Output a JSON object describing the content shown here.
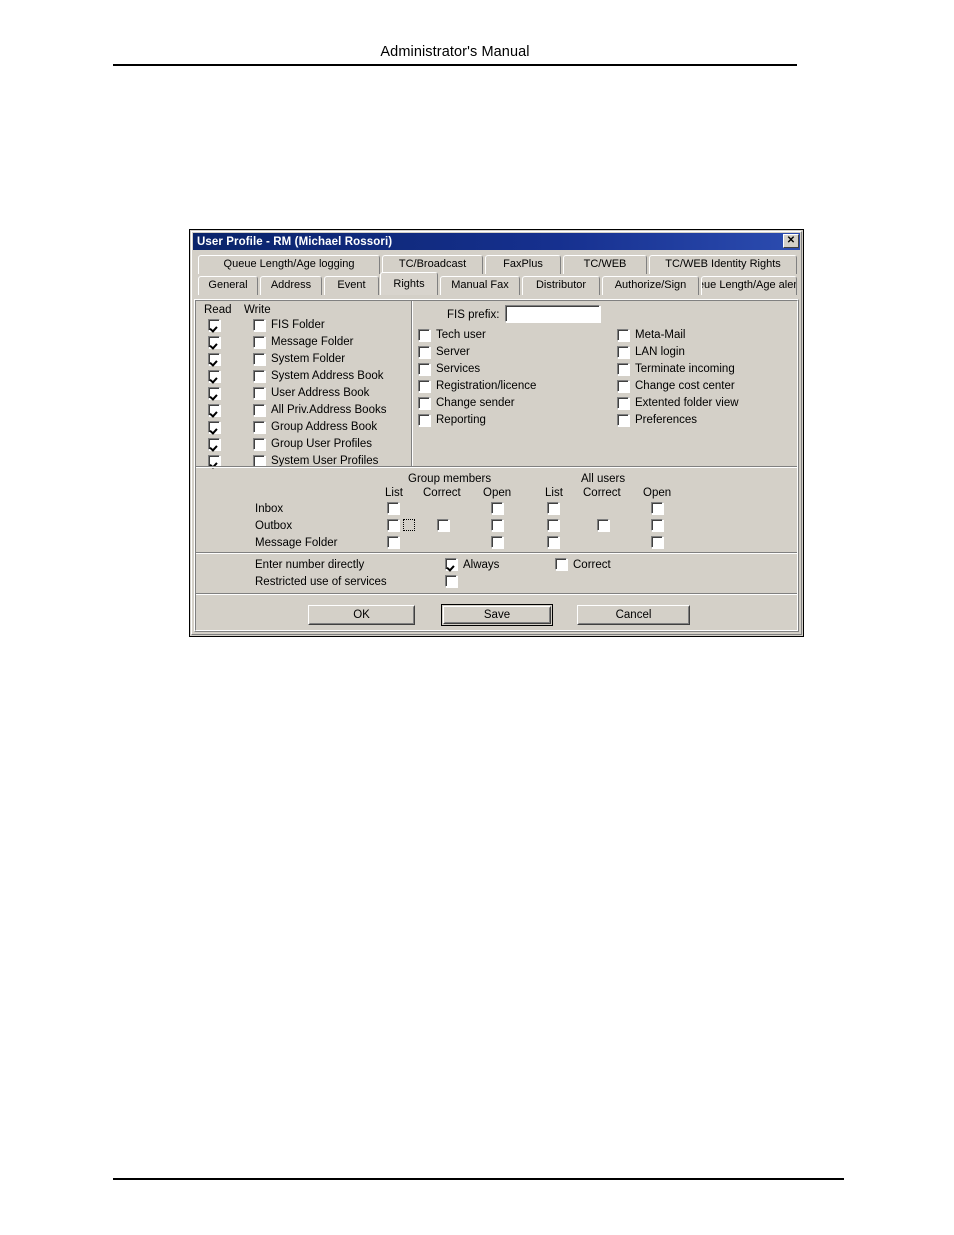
{
  "document": {
    "header_title": "Administrator's Manual"
  },
  "dialog": {
    "title": "User Profile - RM (Michael Rossori)",
    "close_button": "✕",
    "tabs_row1": [
      {
        "label": "Queue Length/Age logging",
        "selected": false
      },
      {
        "label": "TC/Broadcast",
        "selected": false
      },
      {
        "label": "FaxPlus",
        "selected": false
      },
      {
        "label": "TC/WEB",
        "selected": false
      },
      {
        "label": "TC/WEB Identity Rights",
        "selected": false
      }
    ],
    "tabs_row2": [
      {
        "label": "General",
        "selected": false
      },
      {
        "label": "Address",
        "selected": false
      },
      {
        "label": "Event",
        "selected": false
      },
      {
        "label": "Rights",
        "selected": true
      },
      {
        "label": "Manual Fax",
        "selected": false
      },
      {
        "label": "Distributor",
        "selected": false
      },
      {
        "label": "Authorize/Sign",
        "selected": false
      },
      {
        "label": "Queue Length/Age alerting",
        "selected": false
      }
    ],
    "rights_panel": {
      "col_read": "Read",
      "col_write": "Write",
      "rows": [
        {
          "label": "FIS Folder",
          "read": true,
          "write": false
        },
        {
          "label": "Message Folder",
          "read": true,
          "write": false
        },
        {
          "label": "System Folder",
          "read": true,
          "write": false
        },
        {
          "label": "System Address Book",
          "read": true,
          "write": false
        },
        {
          "label": "User Address Book",
          "read": true,
          "write": false
        },
        {
          "label": "All Priv.Address Books",
          "read": true,
          "write": false
        },
        {
          "label": "Group Address Book",
          "read": true,
          "write": false
        },
        {
          "label": "Group User Profiles",
          "read": true,
          "write": false
        },
        {
          "label": "System User Profiles",
          "read": true,
          "write": false
        }
      ]
    },
    "fis_prefix": {
      "label": "FIS prefix:",
      "value": "",
      "placeholder": ""
    },
    "middle_options": [
      {
        "label": "Tech user",
        "checked": false
      },
      {
        "label": "Server",
        "checked": false
      },
      {
        "label": "Services",
        "checked": false
      },
      {
        "label": "Registration/licence",
        "checked": false
      },
      {
        "label": "Change sender",
        "checked": false
      },
      {
        "label": "Reporting",
        "checked": false
      }
    ],
    "right_options": [
      {
        "label": "Meta-Mail",
        "checked": false
      },
      {
        "label": "LAN login",
        "checked": false
      },
      {
        "label": "Terminate incoming",
        "checked": false
      },
      {
        "label": "Change cost center",
        "checked": false
      },
      {
        "label": "Extented folder view",
        "checked": false
      },
      {
        "label": "Preferences",
        "checked": false
      }
    ],
    "access_grid": {
      "group_title": "Group members",
      "all_title": "All users",
      "sub_headers": [
        "List",
        "Correct",
        "Open",
        "List",
        "Correct",
        "Open"
      ],
      "rows": [
        {
          "label": "Inbox",
          "gm_list": false,
          "gm_correct": null,
          "gm_open": false,
          "au_list": false,
          "au_correct": null,
          "au_open": false
        },
        {
          "label": "Outbox",
          "gm_list": false,
          "gm_correct": false,
          "gm_open": false,
          "au_list": false,
          "au_correct": false,
          "au_open": false
        },
        {
          "label": "Message Folder",
          "gm_list": false,
          "gm_correct": null,
          "gm_open": false,
          "au_list": false,
          "au_correct": null,
          "au_open": false
        }
      ],
      "focused_cell": "outbox-list-focus"
    },
    "bottom_options": {
      "enter_number_label": "Enter number directly",
      "always_label": "Always",
      "always_checked": true,
      "correct_label": "Correct",
      "correct_checked": false,
      "restricted_label": "Restricted use of services",
      "restricted_checked": false
    },
    "buttons": [
      {
        "label": "OK",
        "default": false
      },
      {
        "label": "Save",
        "default": true
      },
      {
        "label": "Cancel",
        "default": false
      }
    ]
  }
}
